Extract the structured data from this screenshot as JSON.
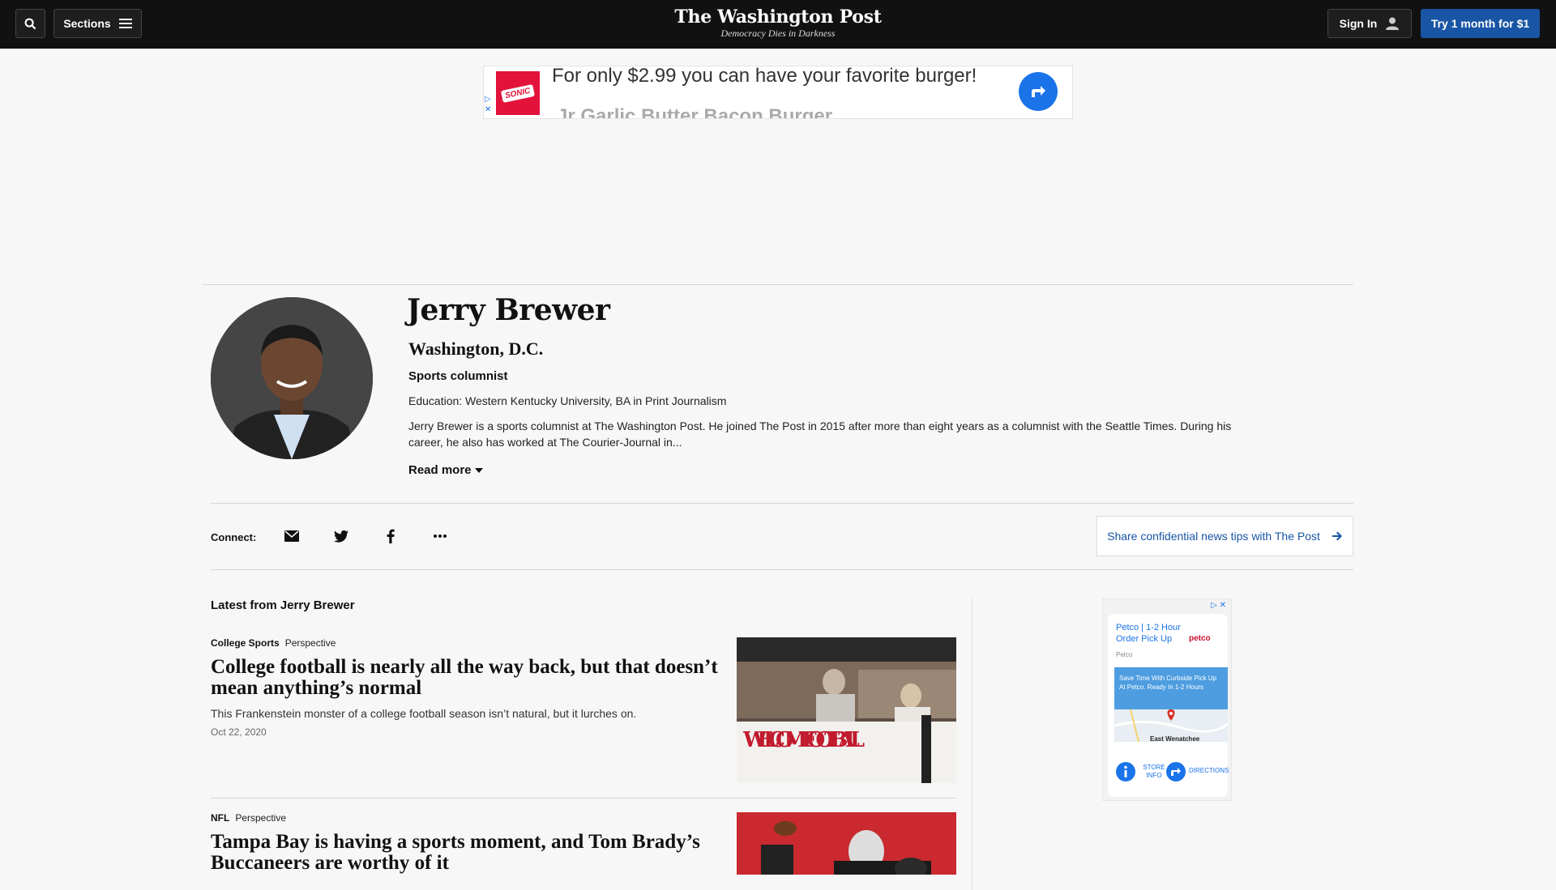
{
  "topbar": {
    "sections_label": "Sections",
    "logo_name": "The Washington Post",
    "logo_tagline": "Democracy Dies in Darkness",
    "signin_label": "Sign In",
    "try_label": "Try 1 month for $1"
  },
  "top_ad": {
    "line1": "For only $2.99 you can have your favorite burger!",
    "line2": "Jr Garlic Butter Bacon Burger",
    "logo_text": "SONIC"
  },
  "author": {
    "name": "Jerry Brewer",
    "location": "Washington, D.C.",
    "role": "Sports columnist",
    "education": "Education: Western Kentucky University, BA in Print Journalism",
    "bio": "Jerry Brewer is a sports columnist at The Washington Post. He joined The Post in 2015 after more than eight years as a columnist with the Seattle Times. During his career, he also has worked at The Courier-Journal in...",
    "read_more": "Read more"
  },
  "connect": {
    "label": "Connect:",
    "tips_label": "Share confidential news tips with The Post"
  },
  "latest": {
    "heading": "Latest from Jerry Brewer",
    "articles": [
      {
        "section": "College Sports",
        "label": "Perspective",
        "headline": "College football is nearly all the way back, but that doesn’t mean anything’s normal",
        "blurb": "This Frankenstein monster of a college football season isn’t natural, but it lurches on.",
        "date": "Oct 22, 2020",
        "image_text": "WELCOME FOOTBALL"
      },
      {
        "section": "NFL",
        "label": "Perspective",
        "headline": "Tampa Bay is having a sports moment, and Tom Brady’s Buccaneers are worthy of it"
      }
    ]
  },
  "side_ad": {
    "title": "Petco | 1-2 Hour Order Pick Up",
    "brand": "petco",
    "source": "Petco",
    "box_text": "Save Time With Curbside Pick Up At Petco. Ready In 1-2 Hours",
    "town": "East Wenatchee",
    "store_info": "STORE INFO",
    "directions": "DIRECTIONS"
  },
  "colors": {
    "topbar": "#111111",
    "accent_blue": "#1955a5",
    "background": "#f7f7f7"
  }
}
